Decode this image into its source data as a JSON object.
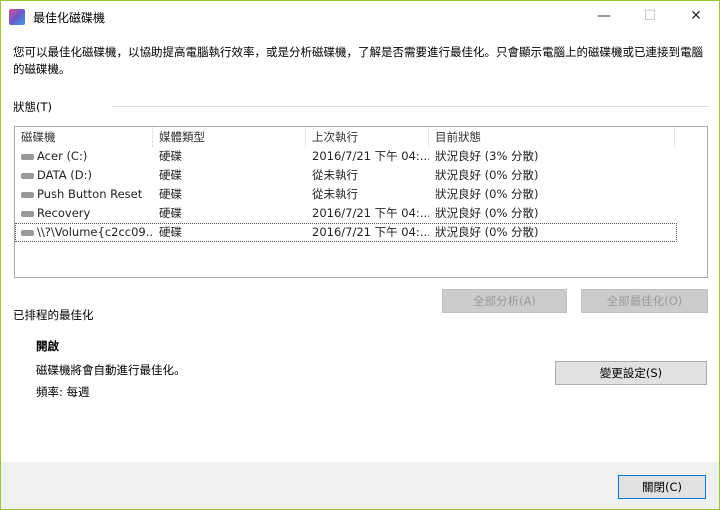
{
  "window": {
    "title": "最佳化磁碟機",
    "minimize": "—",
    "maximize": "☐",
    "close": "✕"
  },
  "description": "您可以最佳化磁碟機，以協助提高電腦執行效率，或是分析磁碟機，了解是否需要進行最佳化。只會顯示電腦上的磁碟機或已連接到電腦的磁碟機。",
  "status_label": "狀態(T)",
  "columns": [
    "磁碟機",
    "媒體類型",
    "上次執行",
    "目前狀態"
  ],
  "drives": [
    {
      "name": "Acer (C:)",
      "type": "硬碟",
      "last": "2016/7/21 下午 04:...",
      "status": "狀況良好 (3% 分散)"
    },
    {
      "name": "DATA (D:)",
      "type": "硬碟",
      "last": "從未執行",
      "status": "狀況良好 (0% 分散)"
    },
    {
      "name": "Push Button Reset",
      "type": "硬碟",
      "last": "從未執行",
      "status": "狀況良好 (0% 分散)"
    },
    {
      "name": "Recovery",
      "type": "硬碟",
      "last": "2016/7/21 下午 04:...",
      "status": "狀況良好 (0% 分散)"
    },
    {
      "name": "\\\\?\\Volume{c2cc09...",
      "type": "硬碟",
      "last": "2016/7/21 下午 04:...",
      "status": "狀況良好 (0% 分散)"
    }
  ],
  "buttons": {
    "analyze_all": "全部分析(A)",
    "optimize_all": "全部最佳化(O)",
    "change_settings": "變更設定(S)",
    "close": "關閉(C)"
  },
  "scheduled": {
    "title": "已排程的最佳化",
    "state": "開啟",
    "info": "磁碟機將會自動進行最佳化。",
    "frequency": "頻率: 每週"
  }
}
